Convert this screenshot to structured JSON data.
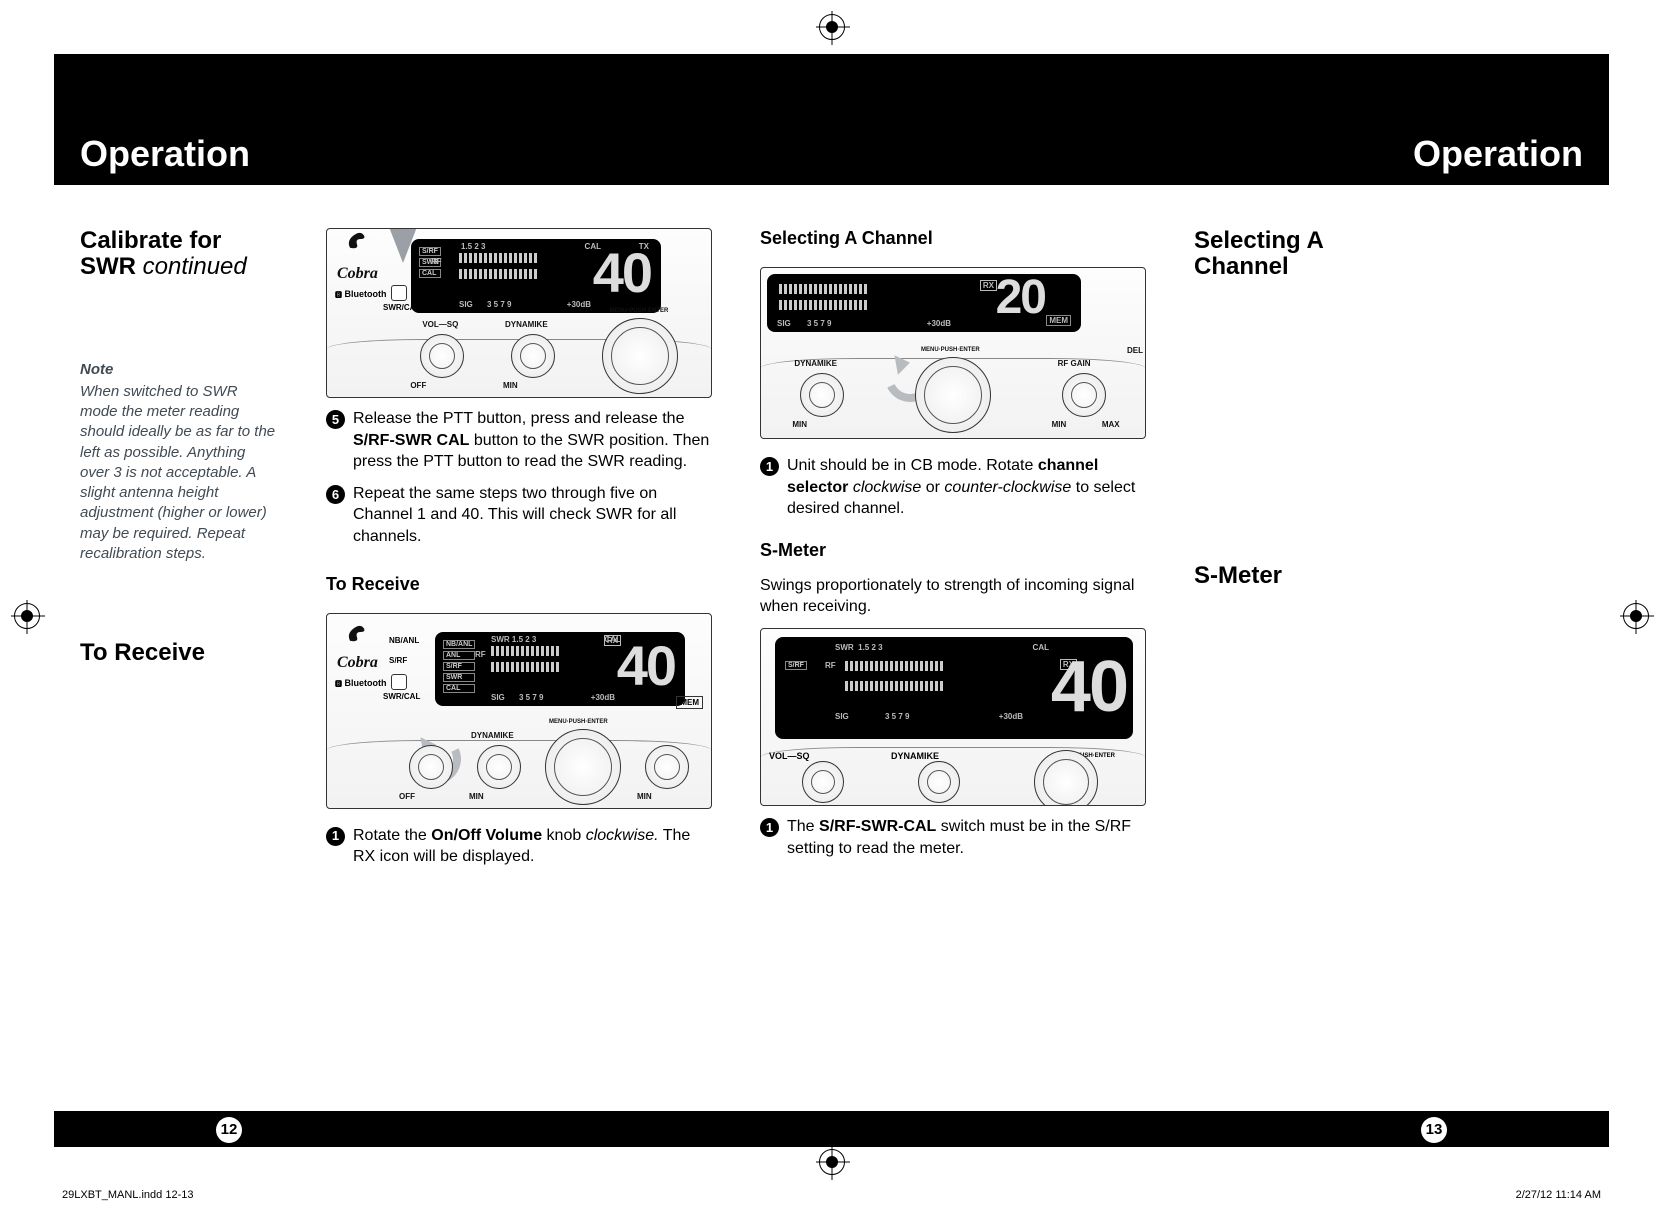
{
  "header": {
    "left": "Operation",
    "right": "Operation"
  },
  "left_col": {
    "calibrate_title_1": "Calibrate for",
    "calibrate_title_2": "SWR",
    "calibrate_cont": " continued",
    "note_label": "Note",
    "note_text": "When switched to SWR mode the meter reading should ideally be as far to the left as possible. Anything over 3 is not acceptable.  A slight antenna height adjustment (higher or lower) may be required. Repeat recalibration steps.",
    "to_receive_title": "To Receive"
  },
  "col2": {
    "step5_pre": "Release the PTT button, press and release the ",
    "step5_bold": "S/RF-SWR CAL",
    "step5_post": " button to the SWR position. Then press the PTT button to read the SWR reading.",
    "step6": "Repeat the same steps two through five on Channel 1 and 40. This will check SWR for all channels.",
    "to_receive_sub": "To Receive",
    "step1_pre": "Rotate the ",
    "step1_bold": "On/Off Volume",
    "step1_mid": " knob ",
    "step1_ital": "clockwise.",
    "step1_post": " The RX icon will be displayed."
  },
  "col3": {
    "sel_sub": "Selecting A Channel",
    "sel_body_pre": "Unit should be in CB mode. Rotate ",
    "sel_body_b1": "channel selector",
    "sel_body_mid1": " ",
    "sel_body_i1": "clockwise",
    "sel_body_mid2": " or ",
    "sel_body_i2": "counter-clockwise",
    "sel_body_post": " to select desired channel.",
    "smeter_sub": "S-Meter",
    "smeter_body": "Swings proportionately to strength of incoming signal when receiving.",
    "smeter_step_pre": "The ",
    "smeter_step_bold": "S/RF-SWR-CAL",
    "smeter_step_post": " switch must be in the S/RF setting to read the meter."
  },
  "col4": {
    "sel_title1": "Selecting A",
    "sel_title2": "Channel",
    "smeter_title": "S-Meter"
  },
  "footer": {
    "page_left": "12",
    "page_right": "13",
    "slug_file": "29LXBT_MANL.indd   12-13",
    "slug_date": "2/27/12   11:14 AM"
  },
  "illus": {
    "ch_big1": "40",
    "ch_big2": "40",
    "ch_big3": "20",
    "ch_big4": "40",
    "labels": {
      "cobra": "Cobra",
      "bt": "Bluetooth",
      "swrcal": "SWR/CAL",
      "vol": "VOL",
      "sq": "SQ",
      "dyn": "DYNAMIKE",
      "off": "OFF",
      "min": "MIN",
      "max": "MAX",
      "rfgain": "RF GAIN",
      "del": "DEL",
      "mem": "MEM",
      "nbanl": "NB/ANL",
      "anl": "ANL",
      "srf": "S/RF",
      "swr": "SWR",
      "cal": "CAL",
      "rf": "RF",
      "sig": "SIG",
      "db": "+30dB",
      "tx": "TX",
      "rx": "RX",
      "nums": "1.5  2   3",
      "snums": "3  5 7 9",
      "menu": "MENU·PUSH·ENTER"
    }
  }
}
